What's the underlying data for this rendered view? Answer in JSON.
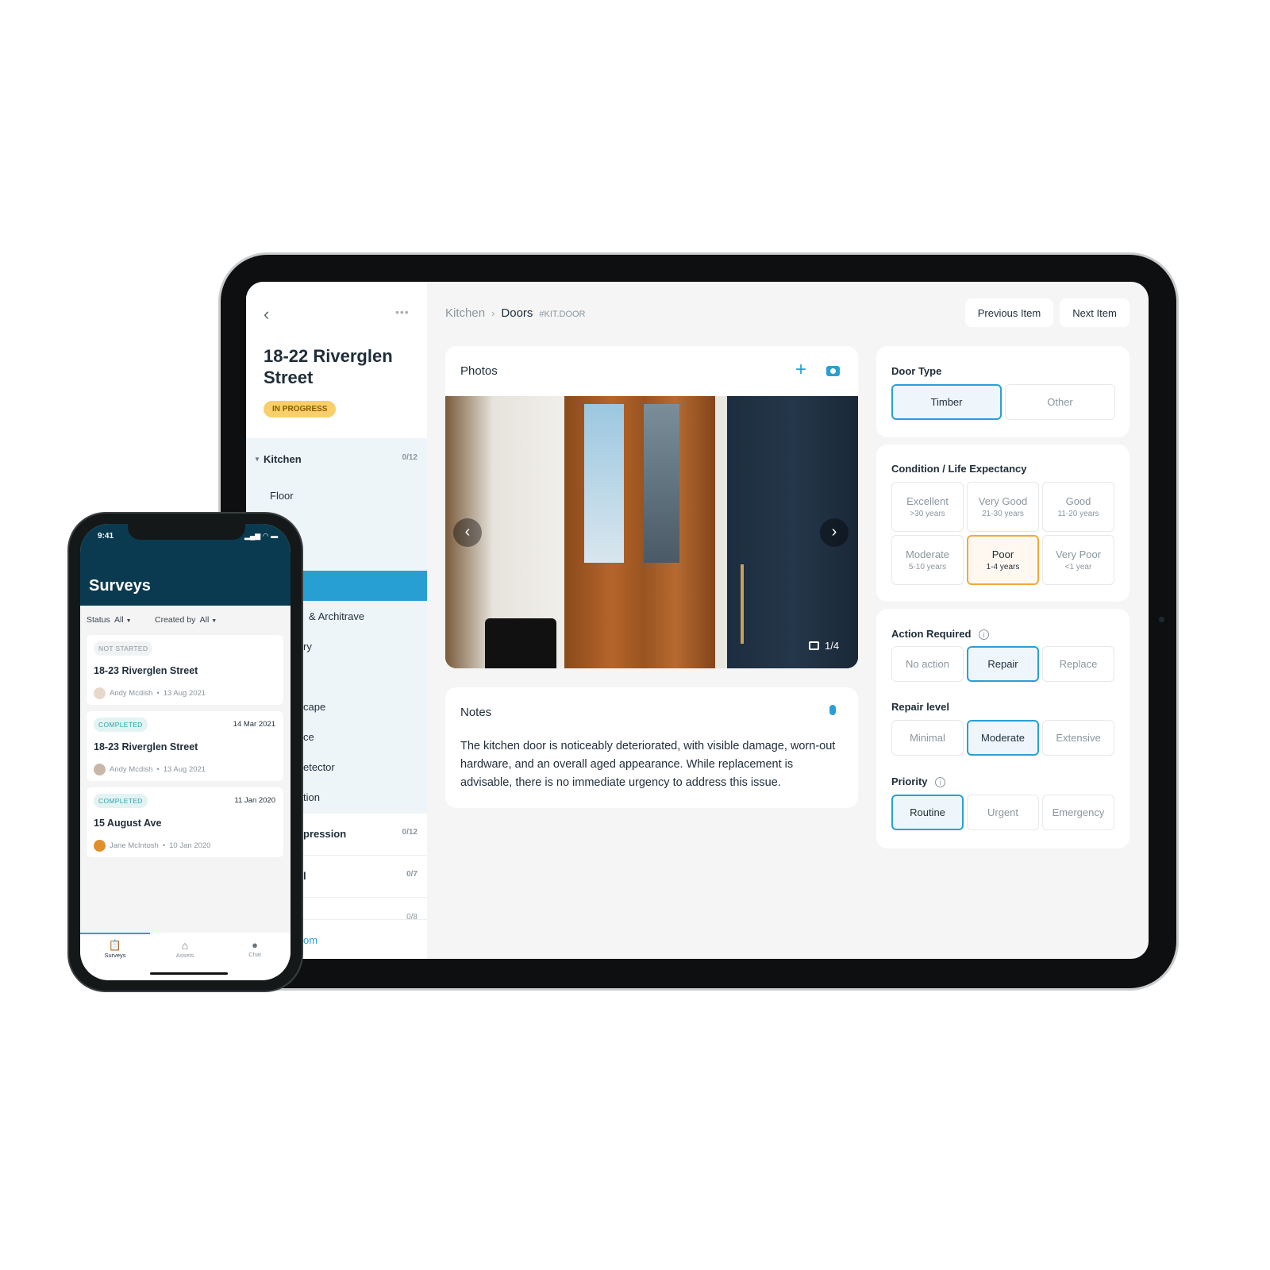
{
  "tablet": {
    "sidebar": {
      "title": "18-22 Riverglen Street",
      "status": "IN PROGRESS",
      "sections": [
        {
          "label": "Kitchen",
          "count": "0/12",
          "items": [
            "Floor",
            "& Architrave",
            "ry",
            "cape",
            "ce",
            "etector",
            "tion"
          ]
        },
        {
          "label": "pression",
          "count": "0/12"
        },
        {
          "label": "l",
          "count": "0/7"
        },
        {
          "label": "",
          "count": "0/8"
        }
      ],
      "footer_link": "om"
    },
    "breadcrumb": {
      "parent": "Kitchen",
      "current": "Doors",
      "code": "#KIT.DOOR"
    },
    "nav": {
      "previous": "Previous Item",
      "next": "Next Item"
    },
    "photos": {
      "title": "Photos",
      "counter": "1/4"
    },
    "notes": {
      "title": "Notes",
      "text": "The kitchen door is noticeably deteriorated, with visible damage, worn-out hardware, and an overall aged appearance. While replacement is advisable, there is no immediate urgency to address this issue."
    },
    "door_type": {
      "label": "Door Type",
      "options": [
        "Timber",
        "Other"
      ],
      "selected": "Timber"
    },
    "condition": {
      "label": "Condition / Life Expectancy",
      "selected": "Poor",
      "options": [
        {
          "name": "Excellent",
          "sub": ">30 years"
        },
        {
          "name": "Very Good",
          "sub": "21-30 years"
        },
        {
          "name": "Good",
          "sub": "11-20 years"
        },
        {
          "name": "Moderate",
          "sub": "5-10 years"
        },
        {
          "name": "Poor",
          "sub": "1-4 years"
        },
        {
          "name": "Very Poor",
          "sub": "<1 year"
        }
      ]
    },
    "action": {
      "label": "Action Required",
      "options": [
        "No action",
        "Repair",
        "Replace"
      ],
      "selected": "Repair"
    },
    "repair_level": {
      "label": "Repair level",
      "options": [
        "Minimal",
        "Moderate",
        "Extensive"
      ],
      "selected": "Moderate"
    },
    "priority": {
      "label": "Priority",
      "options": [
        "Routine",
        "Urgent",
        "Emergency"
      ],
      "selected": "Routine"
    }
  },
  "phone": {
    "time": "9:41",
    "title": "Surveys",
    "filters": {
      "status_label": "Status",
      "status_value": "All",
      "created_label": "Created by",
      "created_value": "All"
    },
    "surveys": [
      {
        "status": "NOT STARTED",
        "date": "",
        "title": "18-23 Riverglen Street",
        "author": "Andy Mcdish",
        "created": "13 Aug 2021"
      },
      {
        "status": "COMPLETED",
        "date": "14 Mar 2021",
        "title": "18-23 Riverglen Street",
        "author": "Andy Mcdish",
        "created": "13 Aug 2021"
      },
      {
        "status": "COMPLETED",
        "date": "11 Jan 2020",
        "title": "15 August Ave",
        "author": "Jane McIntosh",
        "created": "10 Jan 2020"
      }
    ],
    "tabs": [
      {
        "label": "Surveys",
        "icon": "clipboard-icon"
      },
      {
        "label": "Assets",
        "icon": "home-icon"
      },
      {
        "label": "Chat",
        "icon": "chat-icon"
      }
    ],
    "active_tab": "Surveys"
  },
  "colors": {
    "accent": "#2a9fd4",
    "warning": "#f2a93b",
    "header": "#0a3a4f",
    "badge_yellow": "#f8cf6a"
  }
}
